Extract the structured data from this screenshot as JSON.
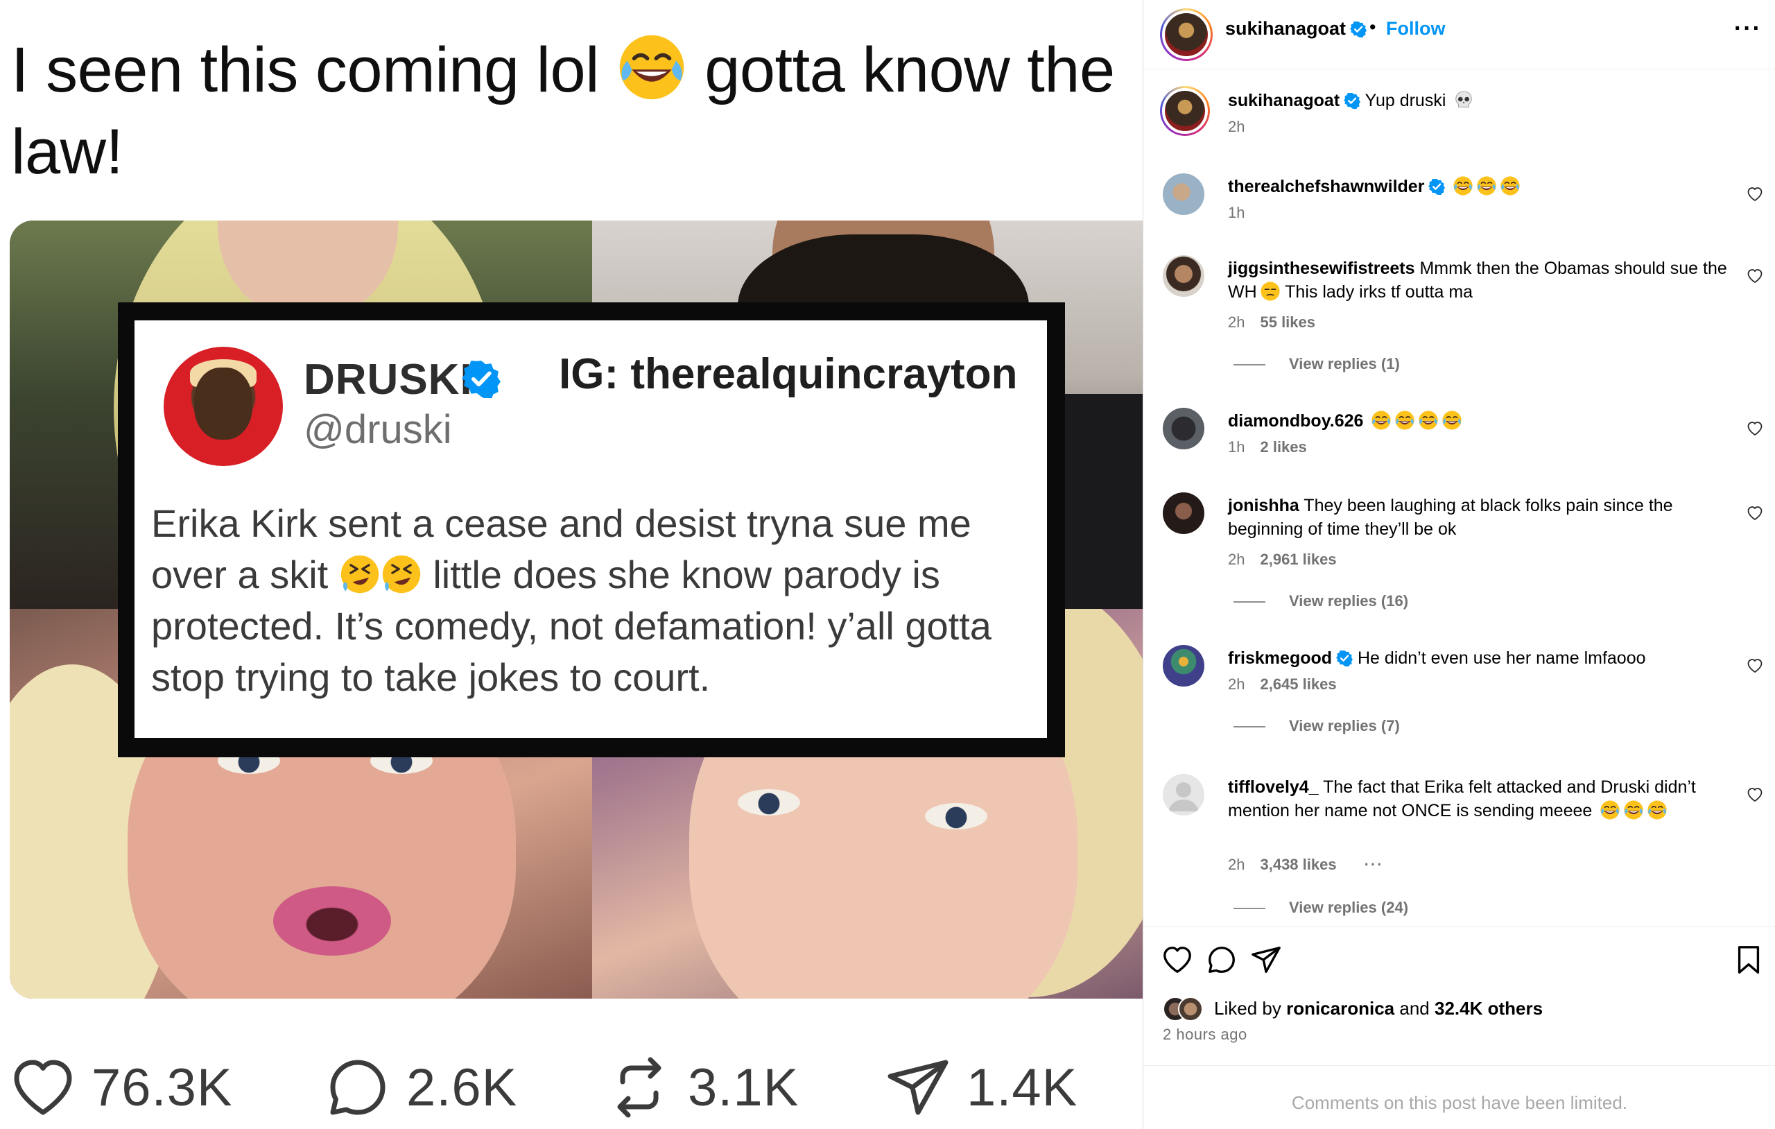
{
  "post": {
    "caption": "I seen this coming lol",
    "caption_after_emoji": "gotta know the law!",
    "tweet": {
      "name": "DRUSKI",
      "handle": "@druski",
      "ig_watermark": "IG: therealquincrayton",
      "body_part1": "Erika Kirk sent a cease and desist tryna sue me over a skit",
      "body_part2": "little does she know parody is protected. It’s comedy, not defamation! y’all gotta stop trying to take jokes to court."
    },
    "counts": {
      "likes": "76.3K",
      "comments": "2.6K",
      "reposts": "3.1K",
      "shares": "1.4K"
    }
  },
  "header": {
    "username": "sukihanagoat",
    "dot": "•",
    "follow_label": "Follow",
    "more_label": "···"
  },
  "comments": [
    {
      "user": "sukihanagoat",
      "verified": true,
      "text": "Yup druski",
      "time": "2h",
      "likes": "",
      "replies": ""
    },
    {
      "user": "therealchefshawnwilder",
      "verified": true,
      "text": "",
      "time": "1h",
      "likes": "",
      "replies": ""
    },
    {
      "user": "jiggsinthesewifistreets",
      "verified": false,
      "text": "Mmmk then the Obamas should sue the WH",
      "text_after": "This lady irks tf outta ma",
      "time": "2h",
      "likes": "55 likes",
      "replies": "View replies (1)"
    },
    {
      "user": "diamondboy.626",
      "verified": false,
      "text": "",
      "time": "1h",
      "likes": "2 likes",
      "replies": ""
    },
    {
      "user": "jonishha",
      "verified": false,
      "text": "They been laughing at black folks pain since the beginning of time they’ll be ok",
      "time": "2h",
      "likes": "2,961 likes",
      "replies": "View replies (16)"
    },
    {
      "user": "friskmegood",
      "verified": true,
      "text": "He didn’t even use her name lmfaooo",
      "time": "2h",
      "likes": "2,645 likes",
      "replies": "View replies (7)"
    },
    {
      "user": "tifflovely4_",
      "verified": false,
      "text": "The fact that Erika felt attacked and Druski didn’t mention her name not ONCE is sending meeee",
      "time": "2h",
      "likes": "3,438 likes",
      "more": "···",
      "replies": "View replies (24)"
    }
  ],
  "footer": {
    "liked_prefix": "Liked by",
    "liked_user": "ronicaronica",
    "liked_and": "and",
    "liked_others": "32.4K others",
    "posted": "2 hours ago",
    "limited_notice": "Comments on this post have been limited."
  },
  "colors": {
    "accent": "#0095f6",
    "verified": "#0095f6",
    "muted": "#737373"
  },
  "icons": [
    "heart-icon",
    "comment-icon",
    "repost-icon",
    "share-icon",
    "bookmark-icon",
    "verified-icon",
    "more-icon",
    "laughing-emoji",
    "rofl-emoji",
    "skull-emoji",
    "unamused-emoji"
  ]
}
